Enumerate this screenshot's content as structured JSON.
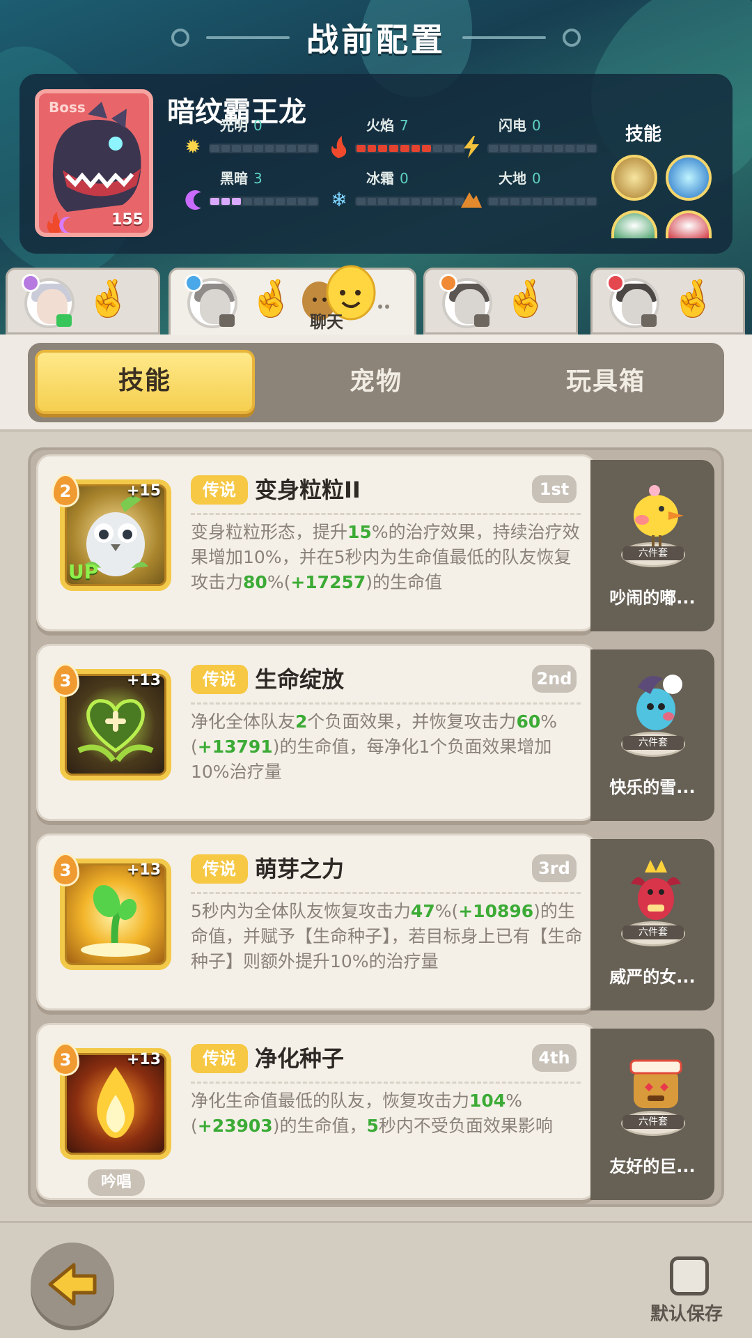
{
  "header": {
    "title": "战前配置"
  },
  "boss": {
    "tag": "Boss",
    "name": "暗纹霸王龙",
    "level": "155",
    "skills_label": "技能",
    "elements": [
      {
        "label": "光明",
        "value": "0",
        "icon": "sun-icon",
        "filled": 0
      },
      {
        "label": "火焰",
        "value": "7",
        "icon": "flame-icon",
        "filled": 7
      },
      {
        "label": "闪电",
        "value": "0",
        "icon": "lightning-icon",
        "filled": 0
      },
      {
        "label": "黑暗",
        "value": "3",
        "icon": "moon-icon",
        "filled": 3
      },
      {
        "label": "冰霜",
        "value": "0",
        "icon": "snowflake-icon",
        "filled": 0
      },
      {
        "label": "大地",
        "value": "0",
        "icon": "mountain-icon",
        "filled": 0
      }
    ]
  },
  "chat": {
    "label": "聊天"
  },
  "tabs": {
    "items": [
      "技能",
      "宠物",
      "玩具箱"
    ],
    "active": 0
  },
  "skills": [
    {
      "level": "2",
      "plus": "+15",
      "up": "UP",
      "rarity": "传说",
      "name": "变身粒粒II",
      "rank": "1st",
      "desc": [
        {
          "t": "变身粒粒形态，提升"
        },
        {
          "t": "15",
          "g": true
        },
        {
          "t": "%的治疗效果，持续治疗效果增加10%，并在5秒内为生命值最低的队友恢复攻击力"
        },
        {
          "t": "80",
          "g": true
        },
        {
          "t": "%("
        },
        {
          "t": "+17257",
          "g": true
        },
        {
          "t": ")的生命值"
        }
      ],
      "pet_name": "吵闹的嘟...",
      "pet_base": "六件套"
    },
    {
      "level": "3",
      "plus": "+13",
      "rarity": "传说",
      "name": "生命绽放",
      "rank": "2nd",
      "desc": [
        {
          "t": "净化全体队友"
        },
        {
          "t": "2",
          "g": true
        },
        {
          "t": "个负面效果，并恢复攻击力"
        },
        {
          "t": "60",
          "g": true
        },
        {
          "t": "%("
        },
        {
          "t": "+13791",
          "g": true
        },
        {
          "t": ")的生命值，每净化1个负面效果增加10%治疗量"
        }
      ],
      "pet_name": "快乐的雪...",
      "pet_base": "六件套"
    },
    {
      "level": "3",
      "plus": "+13",
      "rarity": "传说",
      "name": "萌芽之力",
      "rank": "3rd",
      "desc": [
        {
          "t": "5秒内为全体队友恢复攻击力"
        },
        {
          "t": "47",
          "g": true
        },
        {
          "t": "%("
        },
        {
          "t": "+10896",
          "g": true
        },
        {
          "t": ")的生命值，并赋予【生命种子】，若目标身上已有【生命种子】则额外提升10%的治疗量"
        }
      ],
      "pet_name": "威严的女...",
      "pet_base": "六件套"
    },
    {
      "level": "3",
      "plus": "+13",
      "rarity": "传说",
      "name": "净化种子",
      "rank": "4th",
      "chant": "吟唱",
      "desc": [
        {
          "t": "净化生命值最低的队友，恢复攻击力"
        },
        {
          "t": "104",
          "g": true
        },
        {
          "t": "%("
        },
        {
          "t": "+23903",
          "g": true
        },
        {
          "t": ")的生命值，"
        },
        {
          "t": "5",
          "g": true
        },
        {
          "t": "秒内不受负面效果影响"
        }
      ],
      "pet_name": "友好的巨...",
      "pet_base": "六件套"
    }
  ],
  "footer": {
    "default_save_label": "默认保存",
    "default_save_checked": false
  },
  "colors": {
    "accent_yellow": "#f5cf4f",
    "highlight_green": "#3cab36",
    "rarity_gold": "#f6c844"
  }
}
